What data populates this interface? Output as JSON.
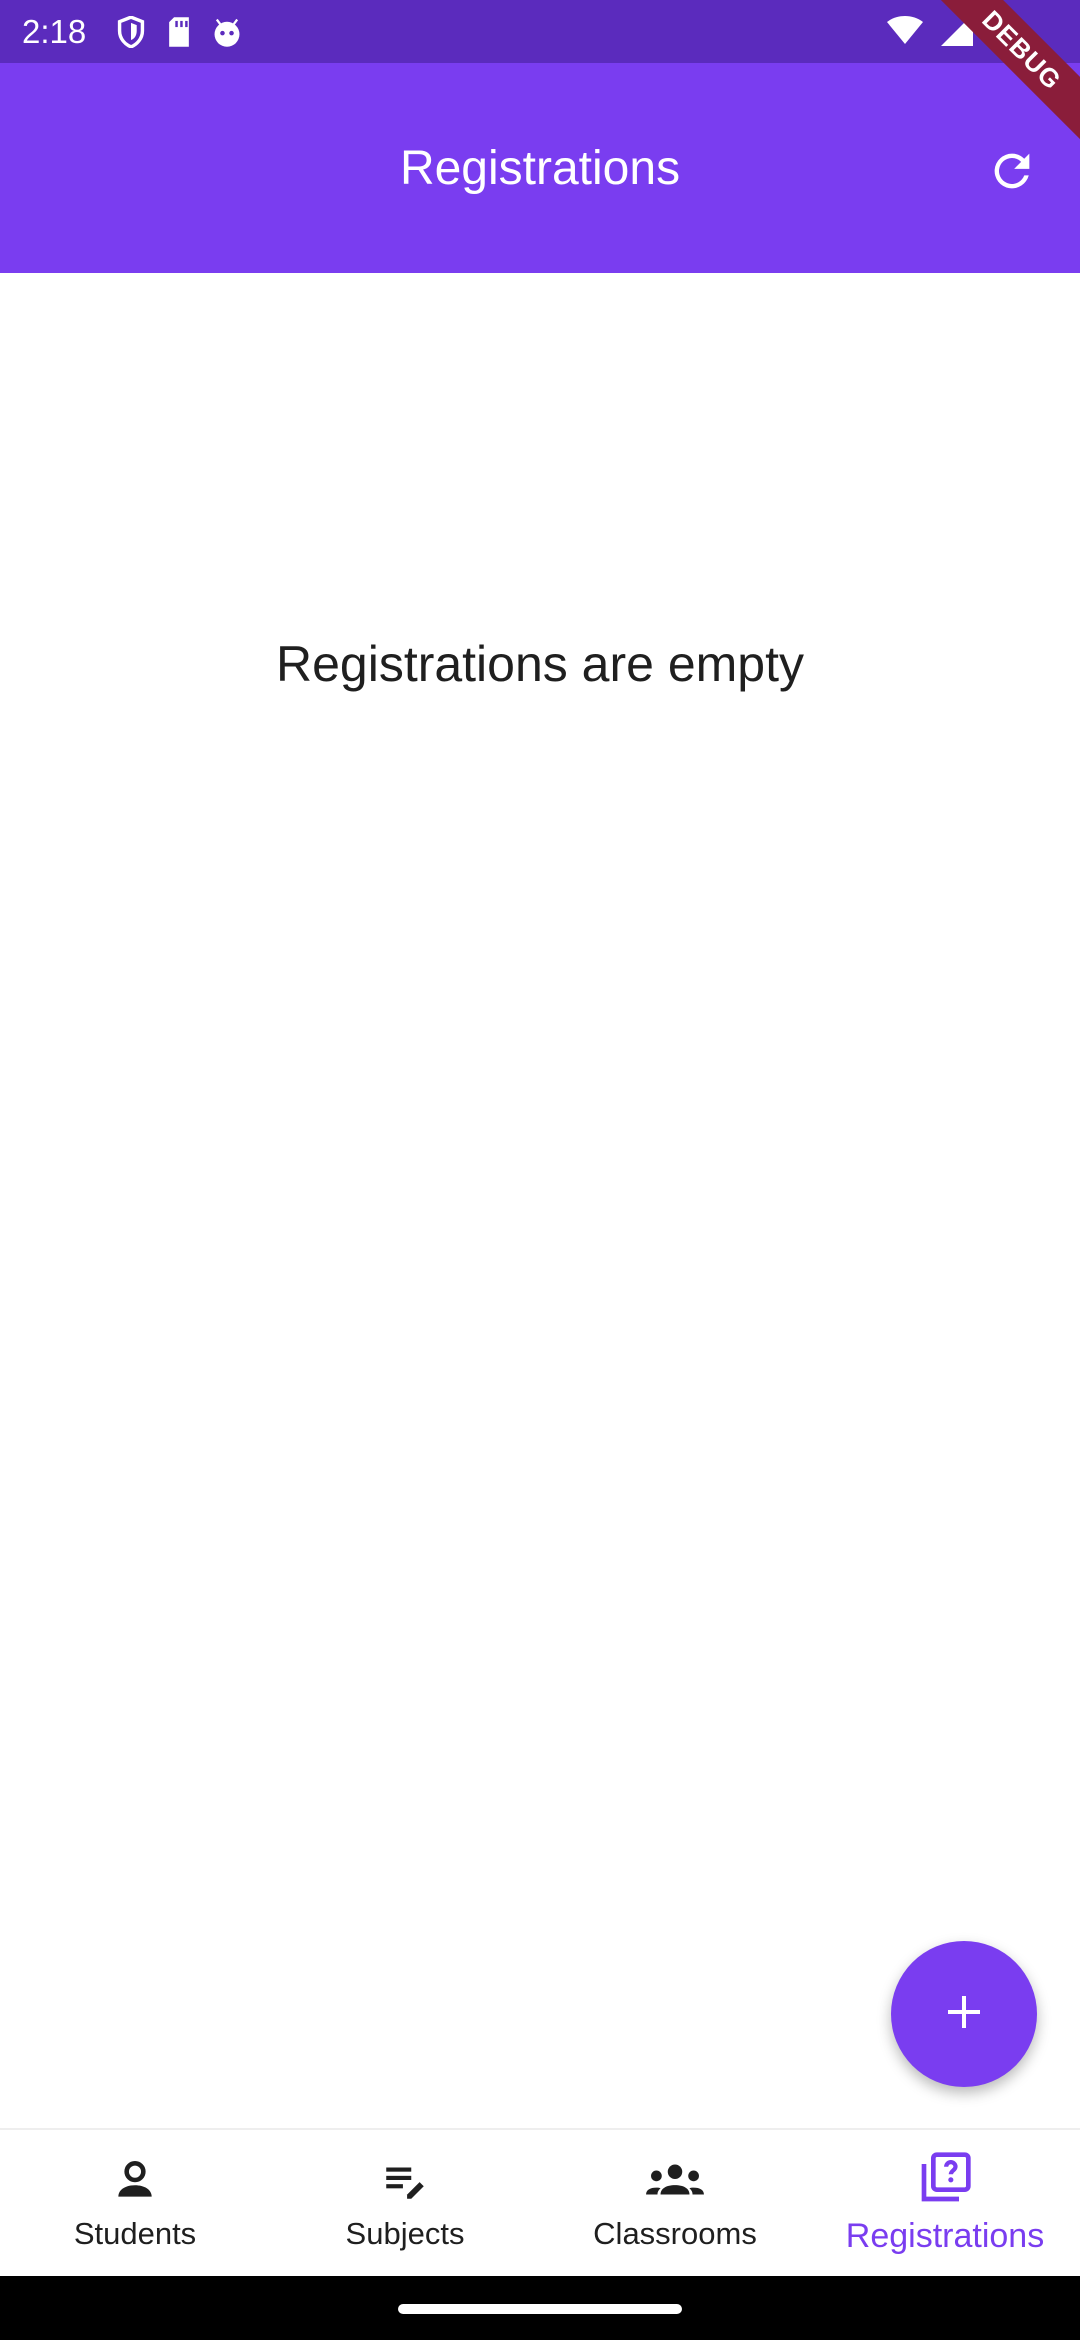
{
  "status_bar": {
    "time": "2:18",
    "icons": [
      "shield-icon",
      "sd-card-icon",
      "android-icon",
      "wifi-icon",
      "signal-icon",
      "battery-icon"
    ]
  },
  "debug_banner": "DEBUG",
  "app_bar": {
    "title": "Registrations",
    "action_icon": "refresh-icon"
  },
  "main": {
    "empty_message": "Registrations are empty"
  },
  "fab": {
    "icon": "add-icon"
  },
  "bottom_nav": {
    "items": [
      {
        "label": "Students",
        "icon": "person-icon"
      },
      {
        "label": "Subjects",
        "icon": "edit-note-icon"
      },
      {
        "label": "Classrooms",
        "icon": "groups-icon"
      },
      {
        "label": "Registrations",
        "icon": "quiz-icon",
        "active": true
      }
    ]
  },
  "colors": {
    "status_bar": "#5b2bbd",
    "primary": "#7a3df0",
    "debug_ribbon": "#8a1d3a"
  }
}
